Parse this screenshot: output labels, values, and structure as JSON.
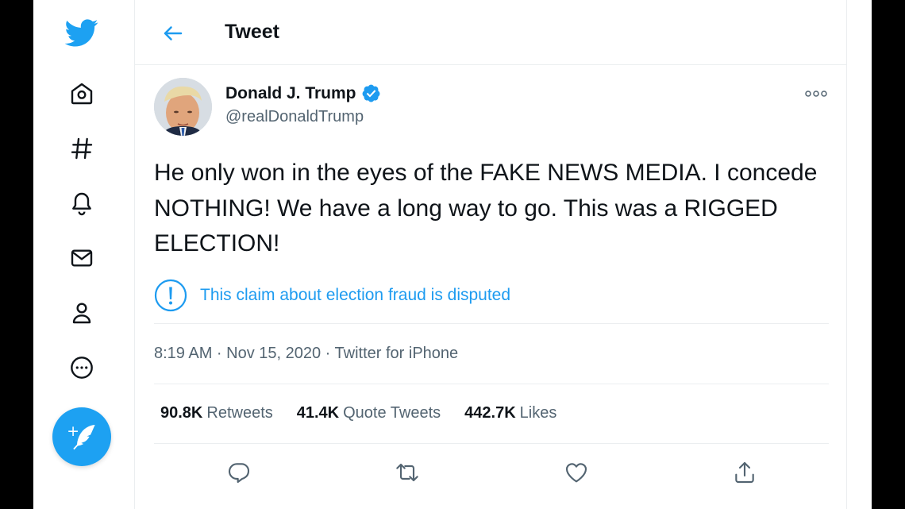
{
  "page": {
    "title": "Tweet"
  },
  "nav": {
    "items": [
      {
        "name": "twitter-logo-icon"
      },
      {
        "name": "home-icon"
      },
      {
        "name": "explore-hashtag-icon"
      },
      {
        "name": "notifications-bell-icon"
      },
      {
        "name": "messages-envelope-icon"
      },
      {
        "name": "profile-person-icon"
      },
      {
        "name": "more-circle-icon"
      }
    ],
    "compose": {
      "icon": "compose-feather-icon"
    }
  },
  "tweet": {
    "author_name": "Donald J. Trump",
    "author_handle": "@realDonaldTrump",
    "verified": true,
    "text": "He only won in the eyes of the FAKE NEWS MEDIA. I concede NOTHING! We have a long way to go. This was a RIGGED ELECTION!",
    "notice": "This claim about election fraud is disputed",
    "time": "8:19 AM",
    "date": "Nov 15, 2020",
    "source": "Twitter for iPhone",
    "meta_line": "8:19 AM · Nov 15, 2020 · Twitter for iPhone"
  },
  "stats": [
    {
      "count": "90.8K",
      "label": "Retweets"
    },
    {
      "count": "41.4K",
      "label": "Quote Tweets"
    },
    {
      "count": "442.7K",
      "label": "Likes"
    }
  ],
  "actions": [
    {
      "icon": "reply-icon"
    },
    {
      "icon": "retweet-icon"
    },
    {
      "icon": "like-heart-icon"
    },
    {
      "icon": "share-icon"
    }
  ],
  "colors": {
    "brand": "#1da1f2",
    "link": "#1d9bf0",
    "text": "#0f1419",
    "muted": "#536471",
    "divider": "#ebeef0"
  }
}
